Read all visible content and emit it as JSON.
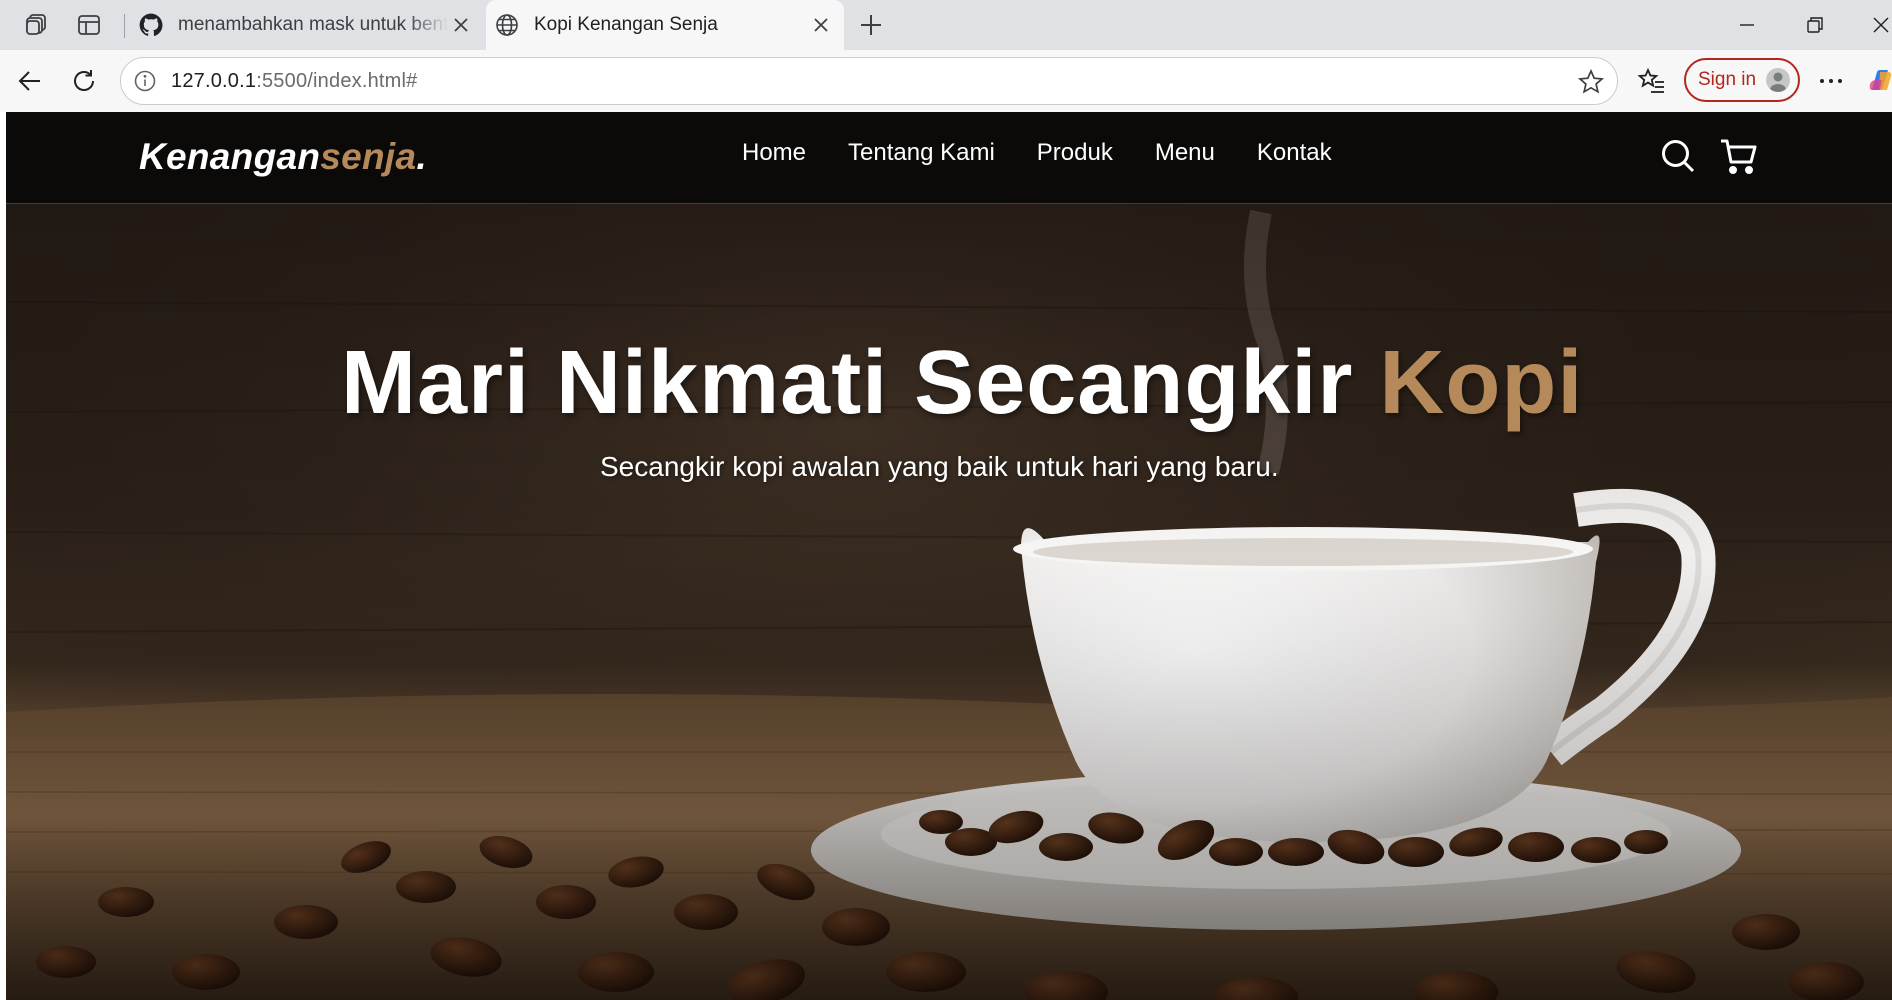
{
  "browser": {
    "tabs": [
      {
        "title": "menambahkan mask untuk bentuk",
        "icon": "github-icon",
        "active": false
      },
      {
        "title": "Kopi Kenangan Senja",
        "icon": "globe-icon",
        "active": true
      }
    ],
    "url_host": "127.0.0.1",
    "url_rest": ":5500/index.html#",
    "signin_label": "Sign in",
    "accent_color": "#b3261e"
  },
  "site": {
    "logo_main": "Kenangan",
    "logo_accent": "senja",
    "logo_dot": ".",
    "accent_color": "#b6895b",
    "menu": [
      "Home",
      "Tentang Kami",
      "Produk",
      "Menu",
      "Kontak"
    ],
    "icons": [
      "search-icon",
      "shopping-cart-icon"
    ],
    "hero": {
      "title_main": "Mari Nikmati Secangkir ",
      "title_accent": "Kopi",
      "subtitle": "Secangkir kopi awalan yang baik untuk hari yang baru."
    }
  }
}
